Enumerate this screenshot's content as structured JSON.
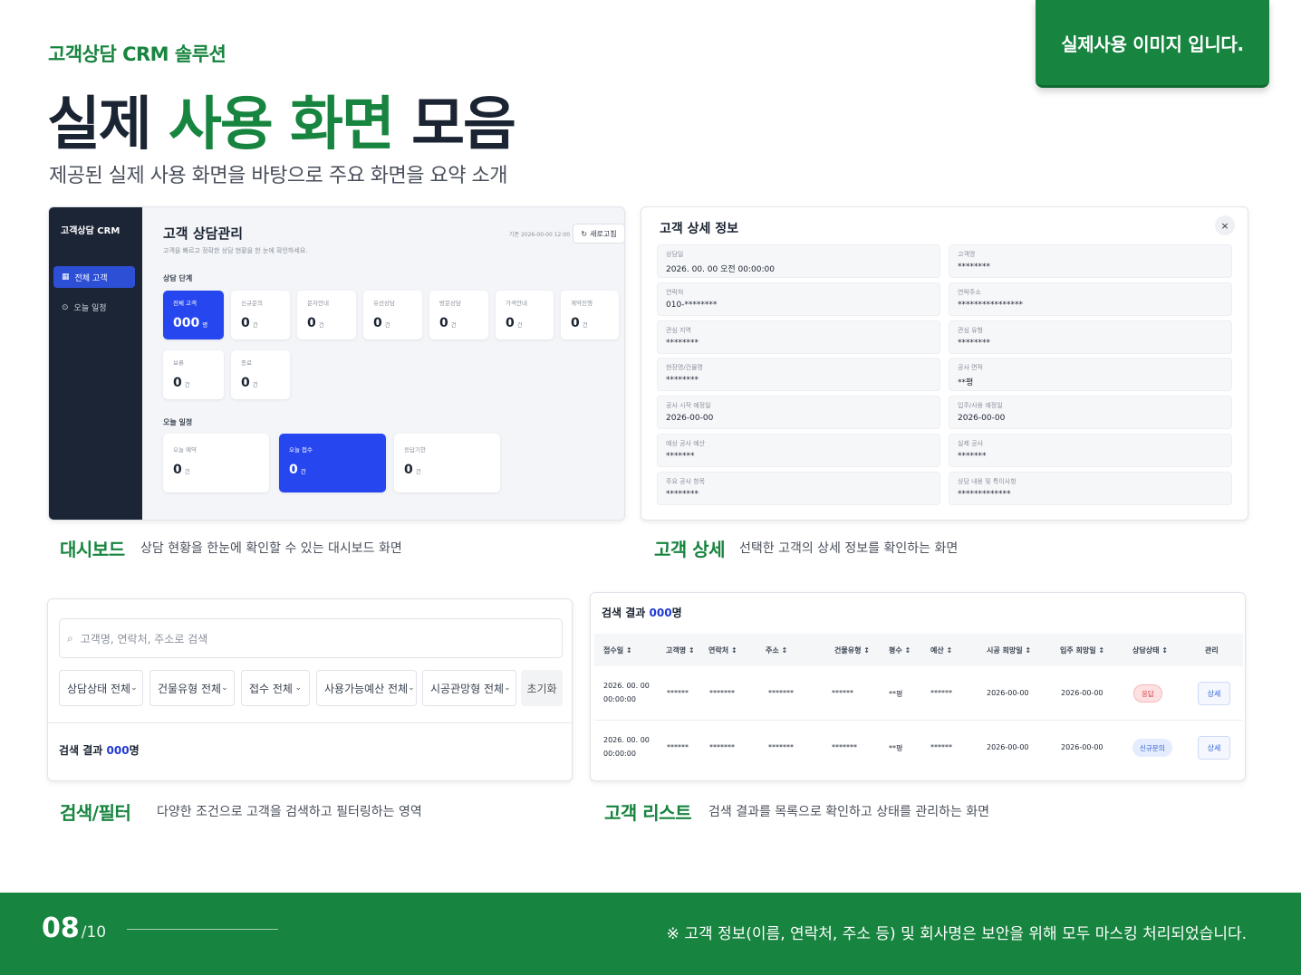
{
  "header": {
    "kicker": "고객상담 CRM 솔루션",
    "title_part1": "실제",
    "title_part2": "사용 화면",
    "title_part3": "모음",
    "subtitle": "제공된 실제 사용 화면을 바탕으로 주요 화면을 요약 소개",
    "badge": "실제사용 이미지 입니다."
  },
  "dashboard": {
    "brand": "고객상담 CRM",
    "nav": [
      {
        "label": "전체 고객",
        "icon": "grid-icon"
      },
      {
        "label": "오늘 일정",
        "icon": "clock-icon"
      }
    ],
    "title": "고객 상담관리",
    "desc": "고객을 빠르고 정확한 상담 현황을 한 눈에 확인하세요.",
    "timestamp": "기준 2026-00-00 12:00",
    "refresh_label": "새로고침",
    "stage_label": "상담 단계",
    "stages": [
      {
        "label": "전체 고객",
        "value": "000",
        "unit": "명"
      },
      {
        "label": "신규문의",
        "value": "0",
        "unit": "건"
      },
      {
        "label": "문자안내",
        "value": "0",
        "unit": "건"
      },
      {
        "label": "유선상담",
        "value": "0",
        "unit": "건"
      },
      {
        "label": "방문상담",
        "value": "0",
        "unit": "건"
      },
      {
        "label": "가격안내",
        "value": "0",
        "unit": "건"
      },
      {
        "label": "계약진행",
        "value": "0",
        "unit": "건"
      },
      {
        "label": "보류",
        "value": "0",
        "unit": "건"
      },
      {
        "label": "종료",
        "value": "0",
        "unit": "건"
      }
    ],
    "today_label": "오늘 일정",
    "today": [
      {
        "label": "오늘 예약",
        "value": "0",
        "unit": "건"
      },
      {
        "label": "오늘 접수",
        "value": "0",
        "unit": "건"
      },
      {
        "label": "응답기한",
        "value": "0",
        "unit": "건"
      }
    ]
  },
  "detail": {
    "title": "고객 상세 정보",
    "close": "×",
    "fields": [
      {
        "label": "상담일",
        "value": "2026. 00. 00 오전 00:00:00"
      },
      {
        "label": "고객명",
        "value": "********"
      },
      {
        "label": "연락처",
        "value": "010-********"
      },
      {
        "label": "연락주소",
        "value": "****************"
      },
      {
        "label": "관심 지역",
        "value": "********"
      },
      {
        "label": "관심 유형",
        "value": "********"
      },
      {
        "label": "현장명/건물명",
        "value": "********"
      },
      {
        "label": "공사 면적",
        "value": "**평"
      },
      {
        "label": "공사 시작 예정일",
        "value": "2026-00-00"
      },
      {
        "label": "입주/사용 예정일",
        "value": "2026-00-00"
      },
      {
        "label": "예상 공사 예산",
        "value": "*******"
      },
      {
        "label": "실제 공사",
        "value": "*******"
      },
      {
        "label": "주요 공사 항목",
        "value": "********"
      },
      {
        "label": "상담 내용 및 특이사항",
        "value": "*************"
      }
    ]
  },
  "captions": {
    "dashboard": {
      "title": "대시보드",
      "desc": "상담 현황을 한눈에 확인할 수 있는 대시보드 화면"
    },
    "detail": {
      "title": "고객 상세",
      "desc": "선택한 고객의 상세 정보를 확인하는 화면"
    },
    "search": {
      "title": "검색/필터",
      "desc": "다양한 조건으로 고객을 검색하고 필터링하는 영역"
    },
    "list": {
      "title": "고객 리스트",
      "desc": "검색 결과를 목록으로 확인하고 상태를 관리하는 화면"
    }
  },
  "search": {
    "placeholder": "고객명, 연락처, 주소로 검색",
    "filters": [
      "상담상태 전체",
      "건물유형 전체",
      "접수 전체",
      "사용가능예산 전체",
      "시공관망형 전체"
    ],
    "reset": "초기화",
    "result_prefix": "검색 결과 ",
    "result_count": "000",
    "result_suffix": "명"
  },
  "list": {
    "result_prefix": "검색 결과 ",
    "result_count": "000",
    "result_suffix": "명",
    "columns": [
      "접수일 ↕",
      "고객명 ↕",
      "연락처 ↕",
      "주소 ↕",
      "건물유형 ↕",
      "평수 ↕",
      "예산 ↕",
      "시공 희망일 ↕",
      "입주 희망일 ↕",
      "상담상태 ↕",
      "관리"
    ],
    "rows": [
      {
        "date1": "2026. 00. 00",
        "date2": "00:00:00",
        "name": "******",
        "phone": "*******",
        "addr": "*******",
        "type": "******",
        "area": "**평",
        "budget": "******",
        "start": "2026-00-00",
        "move": "2026-00-00",
        "status": "응답",
        "action": "상세"
      },
      {
        "date1": "2026. 00. 00",
        "date2": "00:00:00",
        "name": "******",
        "phone": "*******",
        "addr": "*******",
        "type": "*******",
        "area": "**평",
        "budget": "******",
        "start": "2026-00-00",
        "move": "2026-00-00",
        "status": "신규문의",
        "action": "상세"
      }
    ]
  },
  "footer": {
    "page": "08",
    "total": "/10",
    "note": "※ 고객 정보(이름, 연락처, 주소 등) 및 회사명은 보안을 위해 모두 마스킹 처리되었습니다."
  },
  "colors": {
    "brand_green": "#17843f",
    "accent_blue": "#2647f0",
    "sidebar_navy": "#1c2535"
  }
}
